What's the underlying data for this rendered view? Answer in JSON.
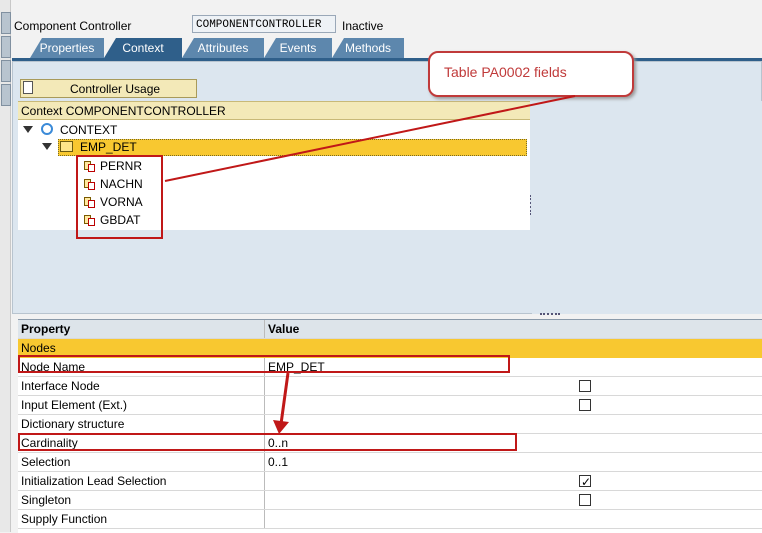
{
  "header": {
    "label": "Component Controller",
    "value": "COMPONENTCONTROLLER",
    "status": "Inactive"
  },
  "tabs": [
    {
      "label": "Properties",
      "active": false
    },
    {
      "label": "Context",
      "active": true
    },
    {
      "label": "Attributes",
      "active": false
    },
    {
      "label": "Events",
      "active": false
    },
    {
      "label": "Methods",
      "active": false
    }
  ],
  "toolbar": {
    "controller_usage_label": "Controller Usage"
  },
  "context_tree": {
    "header": "Context COMPONENTCONTROLLER",
    "root": "CONTEXT",
    "node": "EMP_DET",
    "attributes": [
      "PERNR",
      "NACHN",
      "VORNA",
      "GBDAT"
    ]
  },
  "annotation": {
    "callout_text": "Table PA0002 fields"
  },
  "properties": {
    "headers": {
      "property": "Property",
      "value": "Value"
    },
    "group": "Nodes",
    "rows": [
      {
        "name": "Node Name",
        "value": "EMP_DET"
      },
      {
        "name": "Interface Node",
        "value": "",
        "checked": false
      },
      {
        "name": "Input Element (Ext.)",
        "value": "",
        "checked": false
      },
      {
        "name": "Dictionary structure",
        "value": ""
      },
      {
        "name": "Cardinality",
        "value": "0..n"
      },
      {
        "name": "Selection",
        "value": "0..1"
      },
      {
        "name": "Initialization Lead Selection",
        "value": "",
        "checked": true
      },
      {
        "name": "Singleton",
        "value": "",
        "checked": false
      },
      {
        "name": "Supply Function",
        "value": ""
      }
    ]
  },
  "colors": {
    "tab_active": "#2f5f8a",
    "tab_inactive": "#5d87ad",
    "highlight": "#f8c830",
    "annotation_red": "#c01818"
  }
}
